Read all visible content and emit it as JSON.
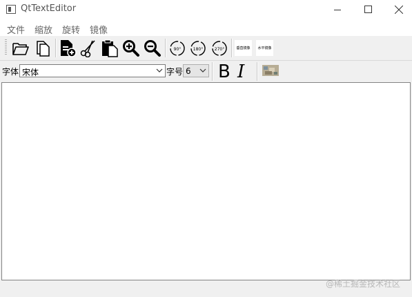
{
  "window": {
    "title": "QtTextEditor"
  },
  "menubar": {
    "items": [
      "文件",
      "缩放",
      "旋转",
      "镜像"
    ]
  },
  "toolbar": {
    "rotate_labels": [
      "90°",
      "180°",
      "270°"
    ],
    "mirror_vertical": "垂直镜像",
    "mirror_horizontal": "水平镜像"
  },
  "format_bar": {
    "font_label": "字体",
    "font_value": "宋体",
    "size_label": "字号",
    "size_value": "6",
    "bold_glyph": "B",
    "italic_glyph": "I"
  },
  "watermark": "@稀土掘金技术社区"
}
